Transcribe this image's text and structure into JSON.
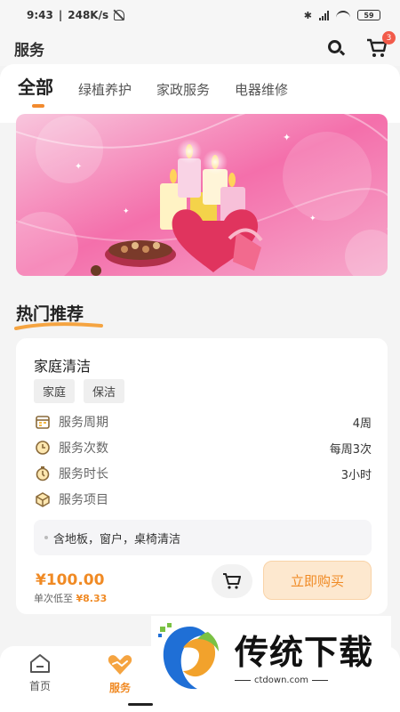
{
  "status_bar": {
    "time": "9:43",
    "net_speed": "248K/s",
    "battery": "59"
  },
  "header": {
    "title": "服务",
    "cart_badge": "3"
  },
  "tabs": [
    {
      "label": "全部",
      "active": true
    },
    {
      "label": "绿植养护",
      "active": false
    },
    {
      "label": "家政服务",
      "active": false
    },
    {
      "label": "电器维修",
      "active": false
    }
  ],
  "section": {
    "hot_title": "热门推荐"
  },
  "card": {
    "title": "家庭清洁",
    "tags": [
      "家庭",
      "保洁"
    ],
    "rows": [
      {
        "icon": "calendar-icon",
        "label": "服务周期",
        "value": "4周"
      },
      {
        "icon": "clock-icon",
        "label": "服务次数",
        "value": "每周3次"
      },
      {
        "icon": "stopwatch-icon",
        "label": "服务时长",
        "value": "3小时"
      },
      {
        "icon": "box-icon",
        "label": "服务项目",
        "value": ""
      }
    ],
    "items_text": "含地板，窗户，桌椅清洁",
    "price": "¥100.00",
    "price_sub_label": "单次低至",
    "price_sub_value": "¥8.33",
    "buy_label": "立即购买"
  },
  "nav": [
    {
      "icon": "home-icon",
      "label": "首页",
      "active": false
    },
    {
      "icon": "service-icon",
      "label": "服务",
      "active": true
    }
  ],
  "watermark": {
    "title": "传统下载",
    "url": "ctdown.com"
  },
  "colors": {
    "accent": "#f08a24",
    "badge": "#f25b4a",
    "banner_pink": "#f25fa0"
  }
}
